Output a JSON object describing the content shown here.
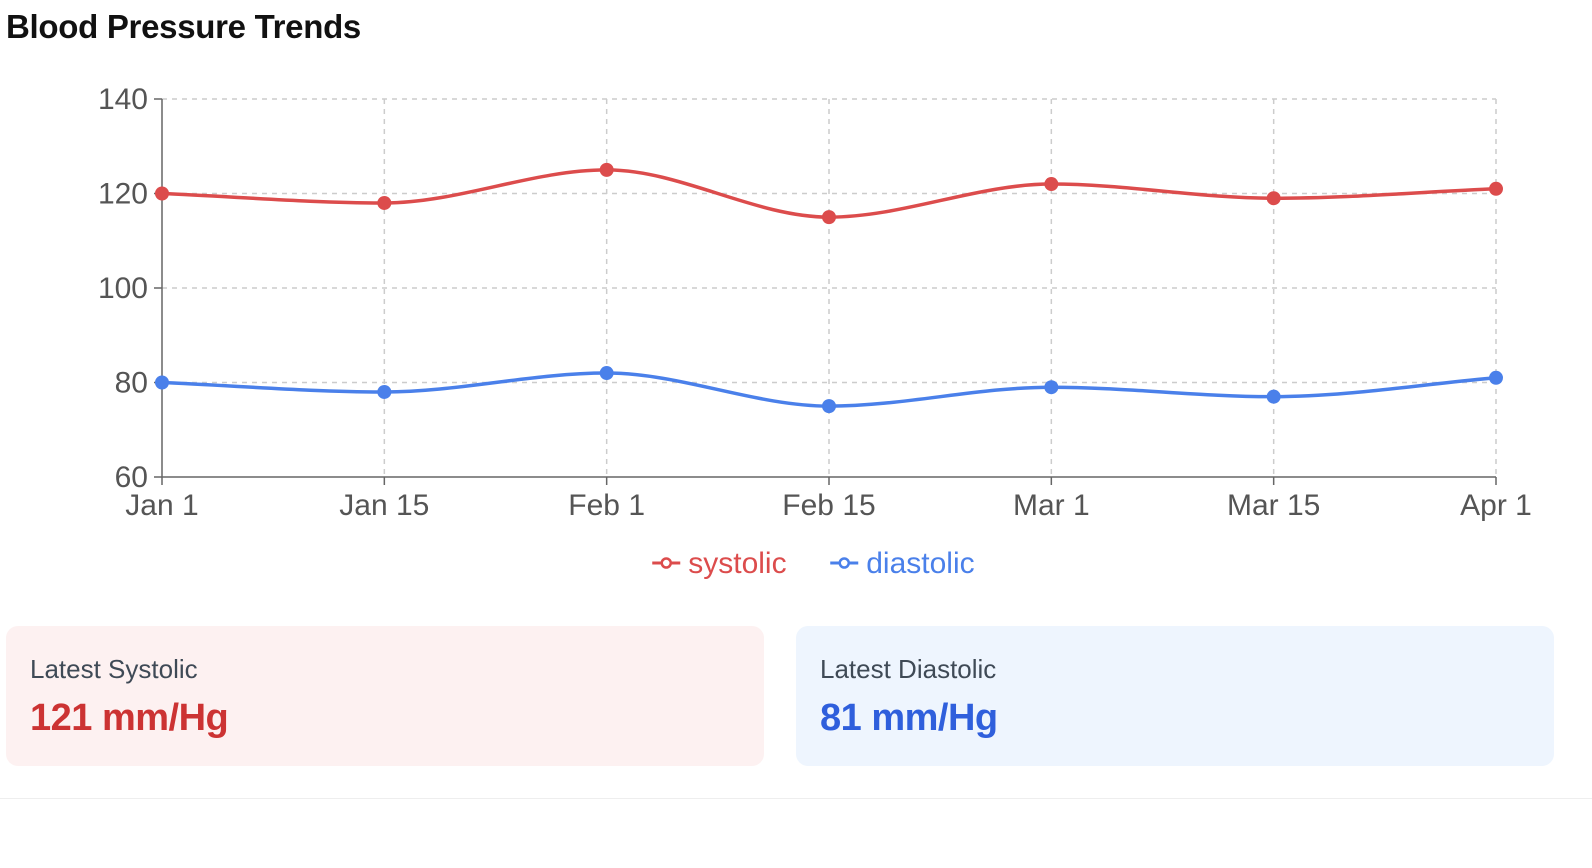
{
  "title": "Blood Pressure Trends",
  "chart_data": {
    "type": "line",
    "x": [
      "Jan 1",
      "Jan 15",
      "Feb 1",
      "Feb 15",
      "Mar 1",
      "Mar 15",
      "Apr 1"
    ],
    "series": [
      {
        "name": "systolic",
        "color": "#dc4c4c",
        "values": [
          120,
          118,
          125,
          115,
          122,
          119,
          121
        ]
      },
      {
        "name": "diastolic",
        "color": "#4a80ea",
        "values": [
          80,
          78,
          82,
          75,
          79,
          77,
          81
        ]
      }
    ],
    "ylim": [
      60,
      140
    ],
    "yticks": [
      60,
      80,
      100,
      120,
      140
    ],
    "grid": true,
    "grid_style": "dashed",
    "legend_position": "bottom-center",
    "curve": "smooth"
  },
  "cards": {
    "systolic": {
      "label": "Latest Systolic",
      "value": "121 mm/Hg",
      "color": "#cc3333",
      "bg": "#fdf1f1"
    },
    "diastolic": {
      "label": "Latest Diastolic",
      "value": "81 mm/Hg",
      "color": "#2f5fdc",
      "bg": "#eef5fe"
    }
  }
}
